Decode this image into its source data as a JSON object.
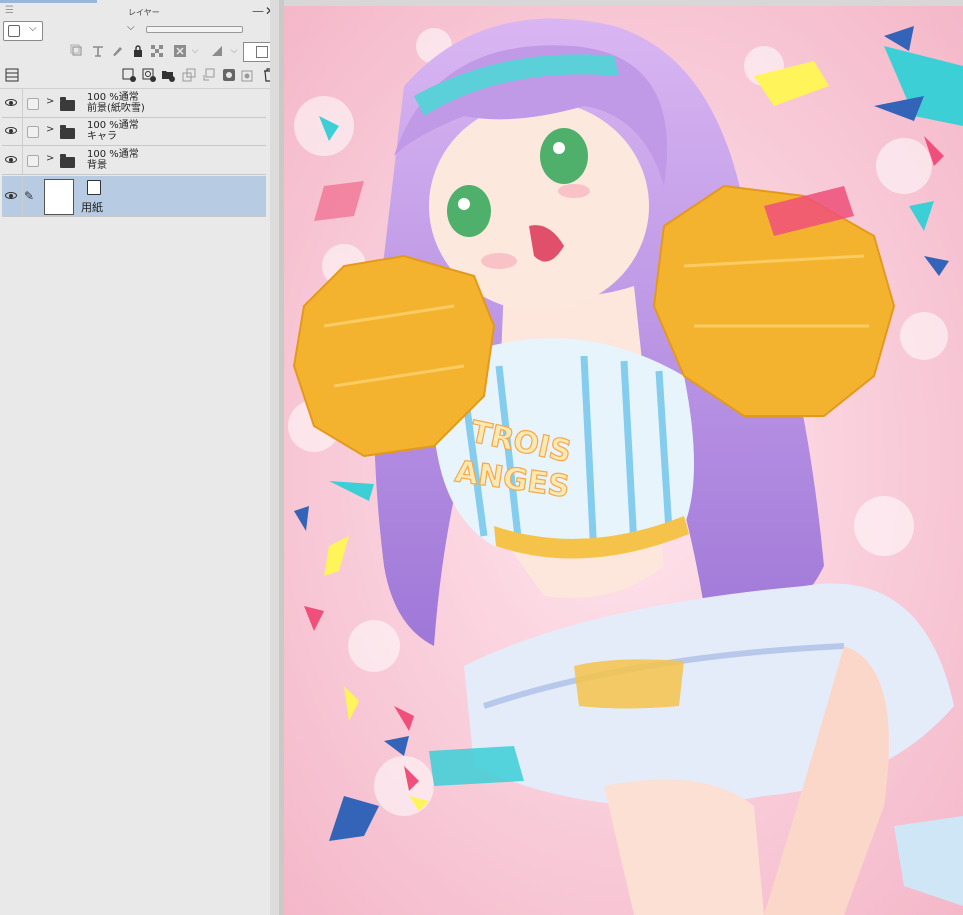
{
  "panel": {
    "title": "レイヤー",
    "menu_glyph": "☰",
    "minimize": "—",
    "close": "✕",
    "chevron": "⌵"
  },
  "layers": [
    {
      "line1": "100 %通常",
      "line2": "前景(紙吹雪)",
      "type": "folder",
      "selected": false
    },
    {
      "line1": "100 %通常",
      "line2": "キャラ",
      "type": "folder",
      "selected": false
    },
    {
      "line1": "100 %通常",
      "line2": "背景",
      "type": "folder",
      "selected": false
    },
    {
      "line1": "",
      "line2": "用紙",
      "type": "paper",
      "selected": true
    }
  ],
  "colors": {
    "selected_layer": "#b7cbe2",
    "panel_bg": "#e9e9e9",
    "canvas_bg": "#f6c9d6",
    "hair": "#b48ee0",
    "pompom": "#f4b32e"
  },
  "canvas": {
    "shirt_text_1": "TROIS",
    "shirt_text_2": "ANGES"
  }
}
